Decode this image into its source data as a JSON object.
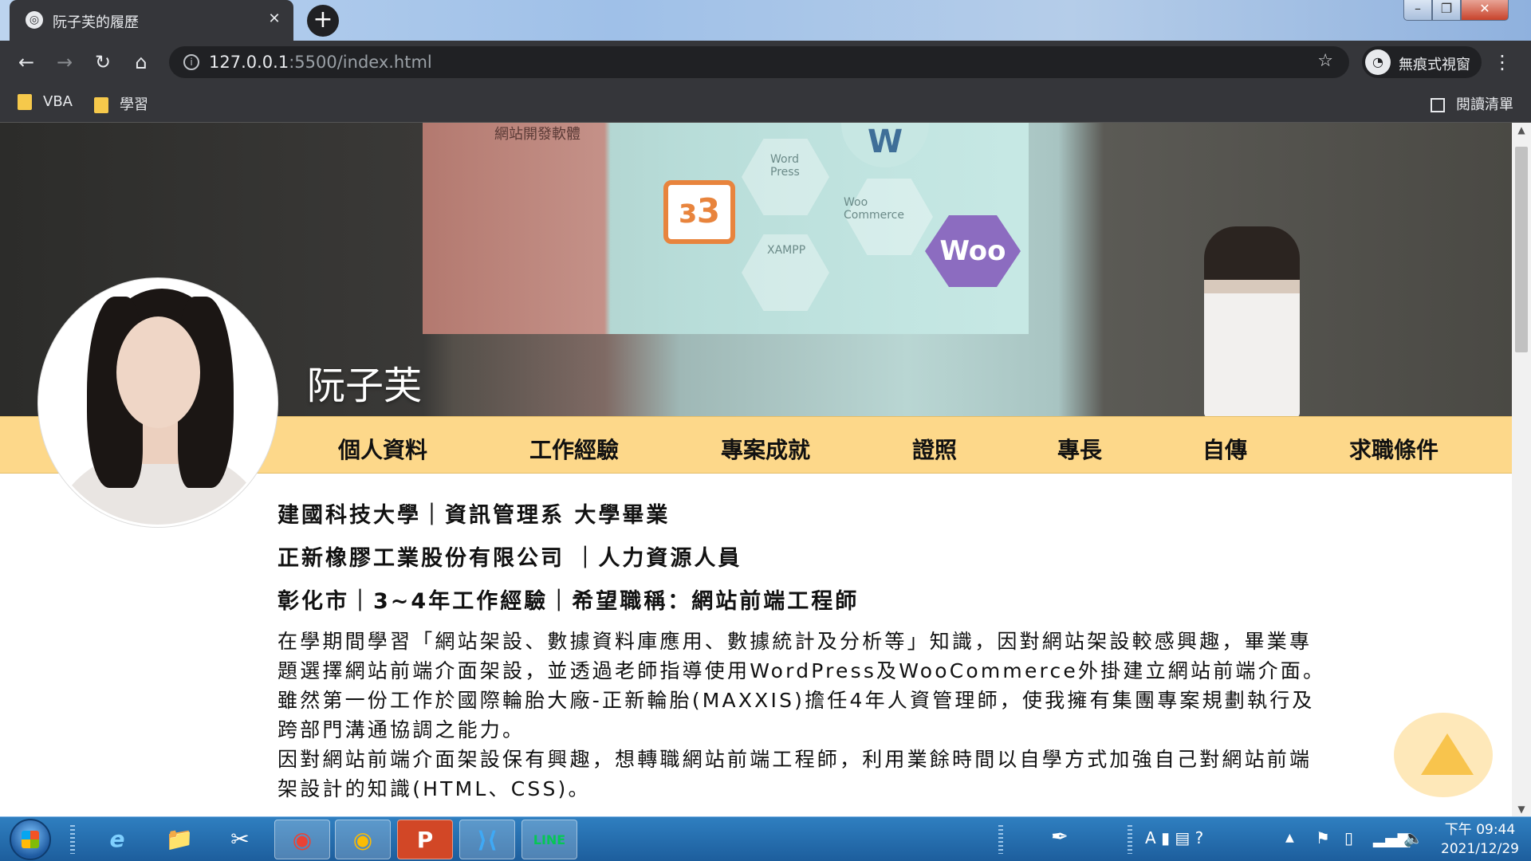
{
  "browser": {
    "tab_title": "阮子芙的履歷",
    "tab_close": "✕",
    "new_tab": "+",
    "url_host": "127.0.0.1",
    "url_rest": ":5500/index.html",
    "incognito_label": "無痕式視窗",
    "bookmarks": [
      {
        "label": "VBA"
      },
      {
        "label": "學習"
      }
    ],
    "reading_list": "閱讀清單"
  },
  "hero": {
    "name": "阮子芙",
    "screen_title": "網站開發軟體",
    "hex_labels": [
      "Word Press",
      "Woo Commerce",
      "XAMPP"
    ],
    "logo_woo": "Woo",
    "logo_wp": "W",
    "logo_xampp": "ɜ3"
  },
  "nav": {
    "items": [
      "個人資料",
      "工作經驗",
      "專案成就",
      "證照",
      "專長",
      "自傳",
      "求職條件"
    ]
  },
  "profile": {
    "school_line": "建國科技大學｜資訊管理系 大學畢業",
    "job_line": "正新橡膠工業股份有限公司 ｜人力資源人員",
    "pref_line": "彰化市｜3~4年工作經驗｜希望職稱：網站前端工程師",
    "bio": [
      "在學期間學習「網站架設、數據資料庫應用、數據統計及分析等」知識，因對網站架設較感興趣，畢業專",
      "題選擇網站前端介面架設，並透過老師指導使用WordPress及WooCommerce外掛建立網站前端介面。",
      "雖然第一份工作於國際輪胎大廠-正新輪胎(MAXXIS)擔任4年人資管理師，使我擁有集團專案規劃執行及",
      "跨部門溝通協調之能力。",
      "因對網站前端介面架設保有興趣，想轉職網站前端工程師，利用業餘時間以自學方式加強自己對網站前端",
      "架設計的知識(HTML、CSS)。"
    ]
  },
  "taskbar": {
    "apps": [
      "e",
      "📁",
      "✂",
      "◉",
      "◉",
      "P",
      "⟩⟨",
      "LINE"
    ],
    "clock_time": "下午 09:44",
    "clock_date": "2021/12/29"
  },
  "colors": {
    "nav_bg": "#fdd88a",
    "chrome_bg": "#35363a",
    "scroll_top": "#f8c44d"
  }
}
